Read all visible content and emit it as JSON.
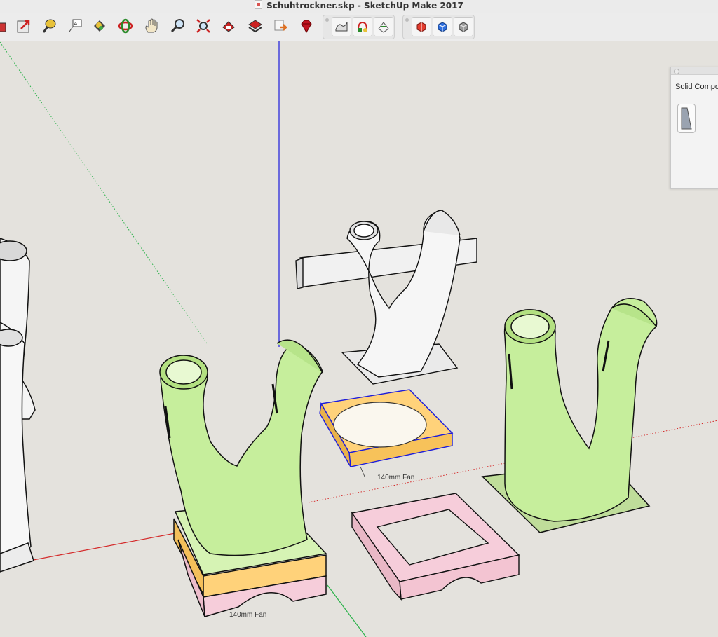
{
  "window": {
    "title": "Schuhtrockner.skp - SketchUp Make 2017"
  },
  "toolbar": {
    "tools": [
      "scale-icon",
      "move-icon",
      "tape-measure-icon",
      "text-tool-icon",
      "paint-bucket-icon",
      "orbit-icon",
      "pan-hand-icon",
      "zoom-icon",
      "zoom-extents-icon",
      "warehouse-icon",
      "extension-warehouse-icon",
      "share-model-icon",
      "ruby-console-icon"
    ],
    "group1": [
      "sandbox-icon",
      "add-location-icon",
      "smoove-icon"
    ],
    "group2": [
      "solid-union-icon",
      "solid-intersect-icon",
      "solid-outer-shell-icon"
    ]
  },
  "tray": {
    "title": "Solid Compo"
  },
  "model_labels": {
    "fan_label_top": "140mm Fan",
    "fan_label_bottom": "140mm Fan"
  },
  "colors": {
    "background": "#e4e2dd",
    "green_part": "#c6ee9c",
    "yellow_plate": "#ffd27a",
    "pink_adapter": "#f6cdda",
    "axis_blue": "#1c1cdb",
    "axis_red": "#d42a2a",
    "axis_green": "#2bb24a"
  }
}
